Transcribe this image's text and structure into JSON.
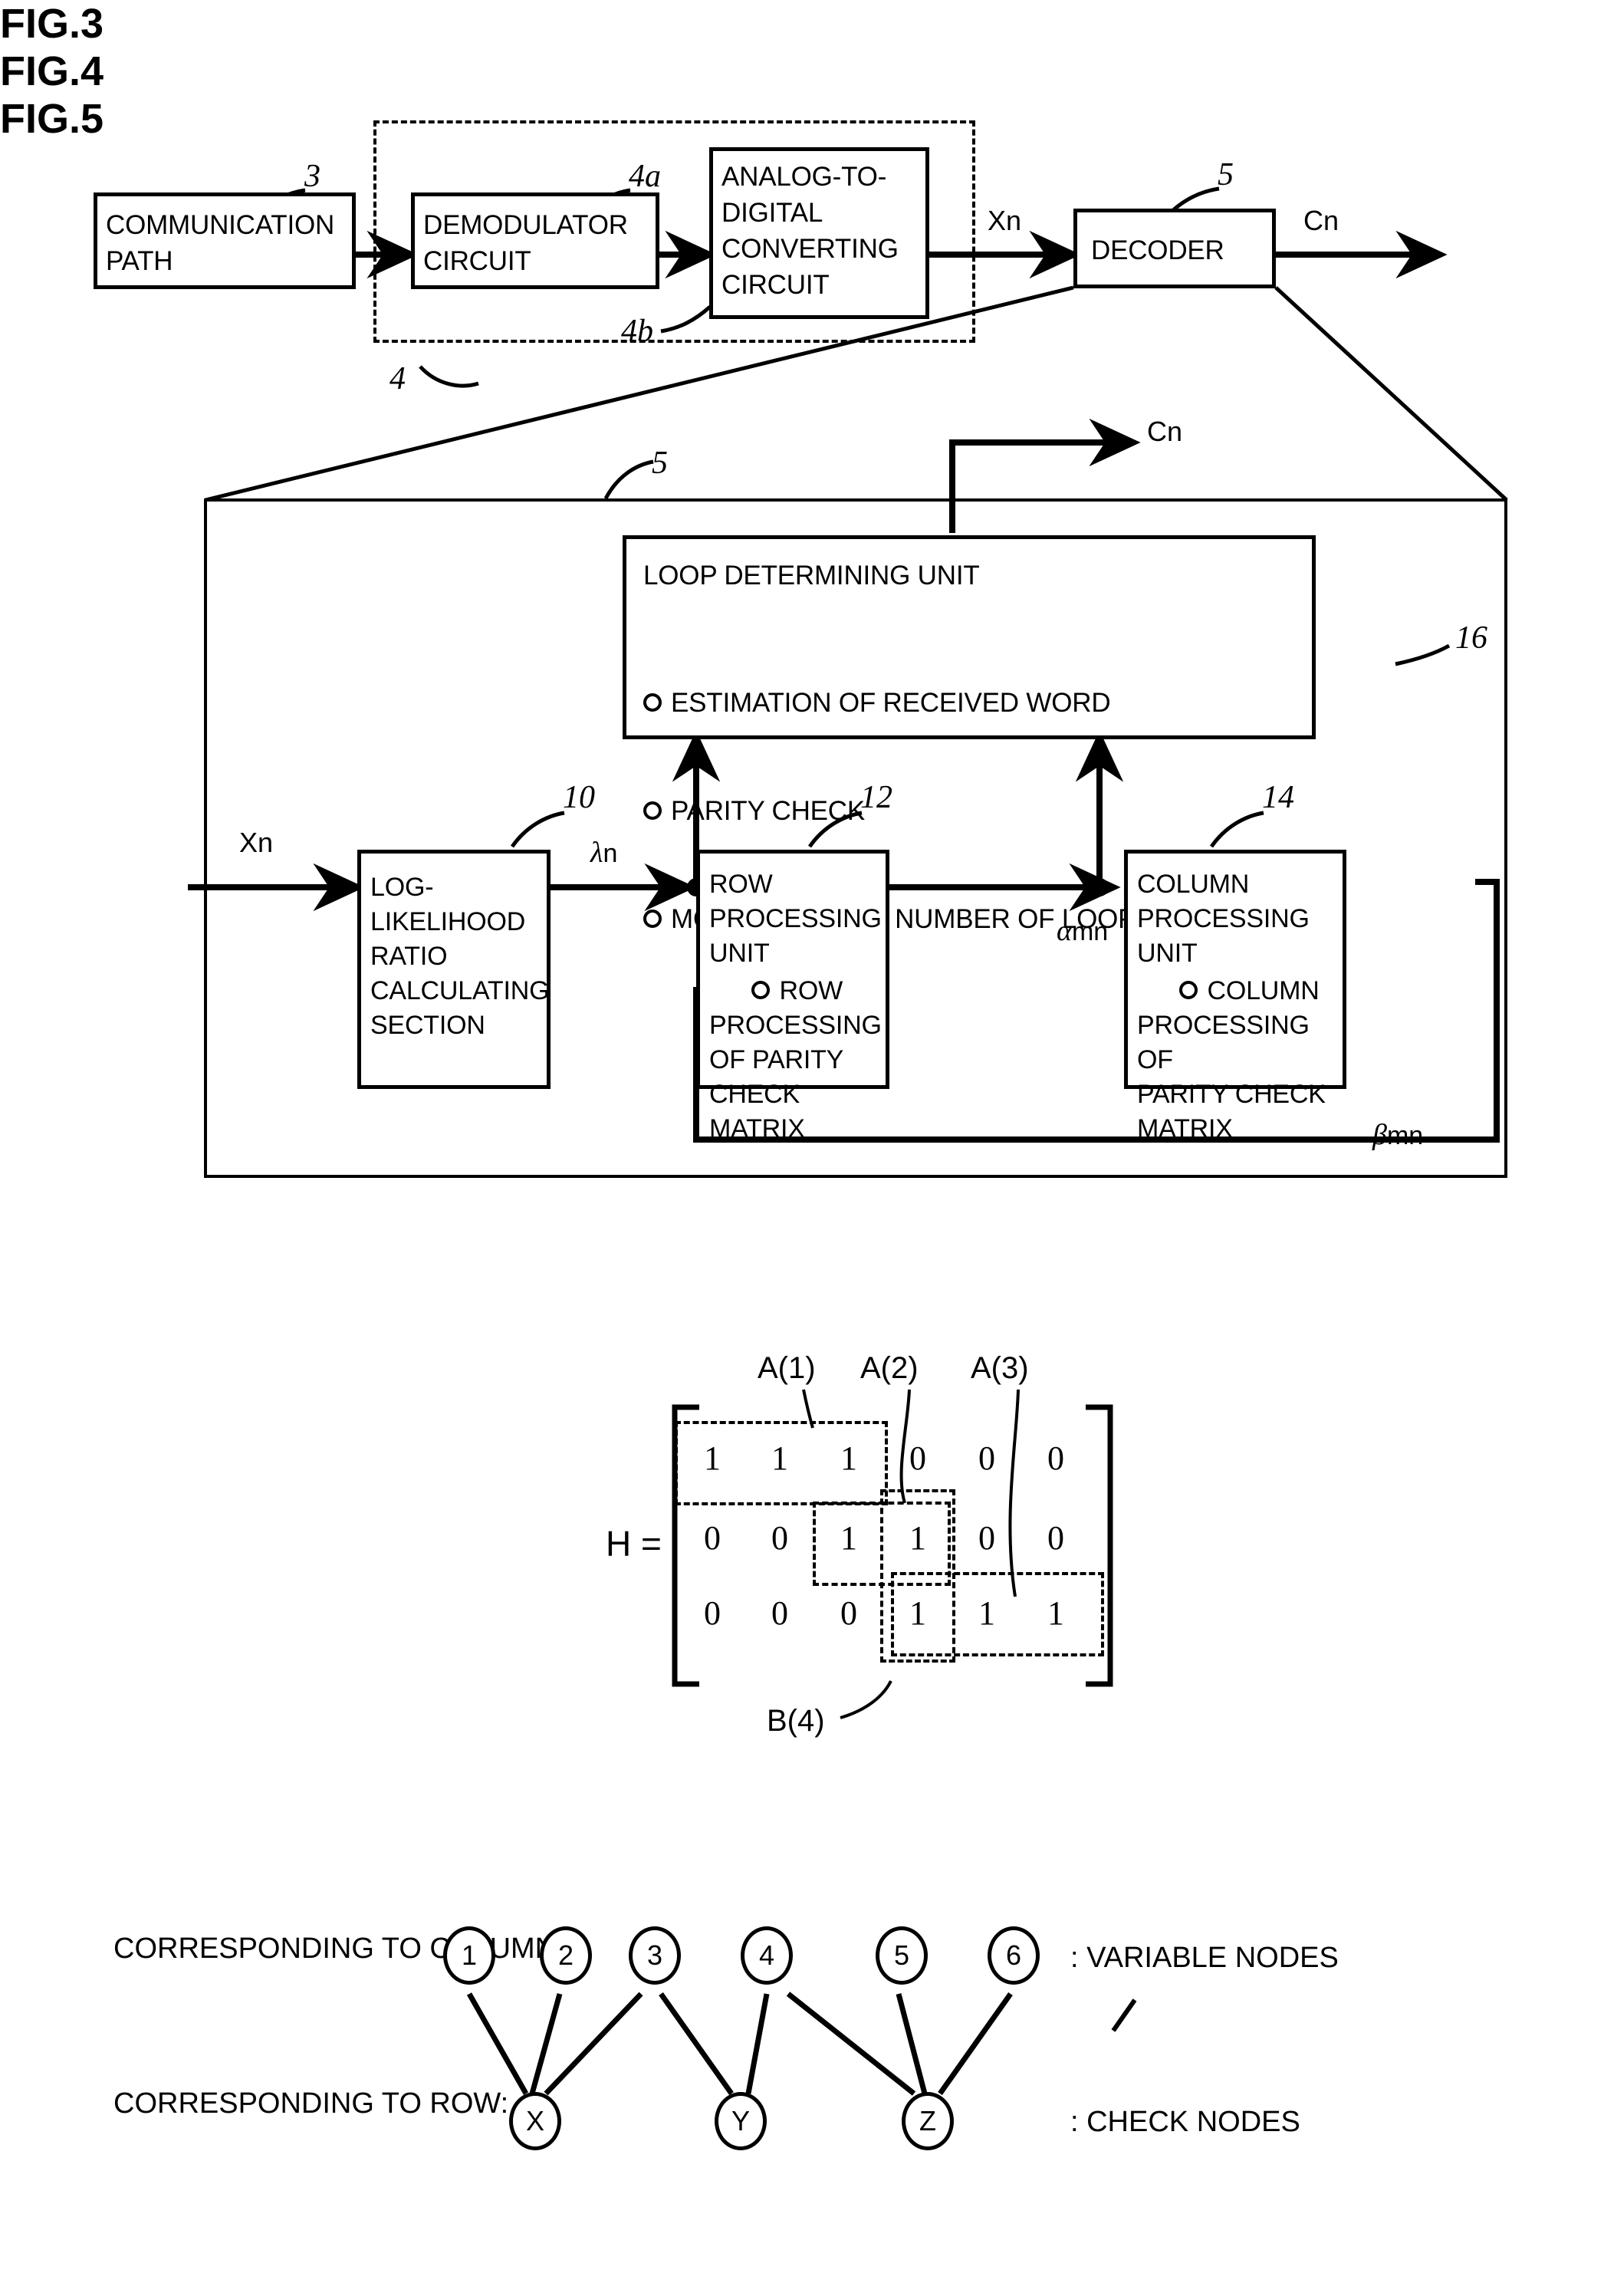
{
  "figures": {
    "fig3": {
      "title": "FIG.3",
      "top_chain": {
        "communication_path": {
          "label": "COMMUNICATION\nPATH",
          "ref": "3"
        },
        "demodulator_circuit": {
          "label": "DEMODULATOR\nCIRCUIT",
          "ref": "4a"
        },
        "ad_converting_circuit": {
          "label": "ANALOG-TO-\nDIGITAL\nCONVERTING\nCIRCUIT",
          "ref": "4b"
        },
        "receiver_group_ref": "4",
        "decoder": {
          "label": "DECODER",
          "ref": "5"
        },
        "signal_in": "Xn",
        "signal_out": "Cn"
      },
      "decoder_detail": {
        "ref": "5",
        "output_signal": "Cn",
        "input_signal": "Xn",
        "loop_determining_unit": {
          "title": "LOOP DETERMINING UNIT",
          "items": [
            "ESTIMATION OF RECEIVED WORD",
            "PARITY CHECK",
            "MONITORING OF NUMBER OF LOOP TIMES"
          ],
          "ref": "16"
        },
        "llr_section": {
          "label": "LOG-\nLIKELIHOOD\nRATIO\nCALCULATING\nSECTION",
          "ref": "10"
        },
        "row_processing_unit": {
          "title": "ROW PROCESSING\nUNIT",
          "item": "ROW\nPROCESSING\nOF PARITY\nCHECK MATRIX",
          "ref": "12"
        },
        "column_processing_unit": {
          "title": "COLUMN\nPROCESSING UNIT",
          "item": "COLUMN\nPROCESSING OF\nPARITY CHECK\nMATRIX",
          "ref": "14"
        },
        "signals": {
          "lambda_n": {
            "greek": "λ",
            "sub": "n"
          },
          "alpha_mn": {
            "greek": "α",
            "sub": "mn"
          },
          "beta_mn": {
            "greek": "β",
            "sub": "mn"
          }
        }
      }
    },
    "fig4": {
      "title": "FIG.4",
      "matrix_name": "H =",
      "matrix": [
        [
          "1",
          "1",
          "1",
          "0",
          "0",
          "0"
        ],
        [
          "0",
          "0",
          "1",
          "1",
          "0",
          "0"
        ],
        [
          "0",
          "0",
          "0",
          "1",
          "1",
          "1"
        ]
      ],
      "callouts": [
        {
          "name": "A(1)"
        },
        {
          "name": "A(2)"
        },
        {
          "name": "A(3)"
        },
        {
          "name": "B(4)"
        }
      ]
    },
    "fig5": {
      "title": "FIG.5",
      "left_labels": {
        "column": "CORRESPONDING\nTO COLUMN:",
        "row": "CORRESPONDING\nTO ROW:"
      },
      "variable_nodes": [
        "1",
        "2",
        "3",
        "4",
        "5",
        "6"
      ],
      "check_nodes": [
        "X",
        "Y",
        "Z"
      ],
      "right_labels": {
        "variable": ": VARIABLE NODES",
        "check": ": CHECK NODES"
      },
      "edges": [
        {
          "from": "1",
          "to": "X"
        },
        {
          "from": "2",
          "to": "X"
        },
        {
          "from": "3",
          "to": "X"
        },
        {
          "from": "3",
          "to": "Y"
        },
        {
          "from": "4",
          "to": "Y"
        },
        {
          "from": "4",
          "to": "Z"
        },
        {
          "from": "5",
          "to": "Z"
        },
        {
          "from": "6",
          "to": "Z"
        }
      ]
    }
  },
  "colors": {
    "ink": "#000000",
    "paper": "#ffffff"
  }
}
